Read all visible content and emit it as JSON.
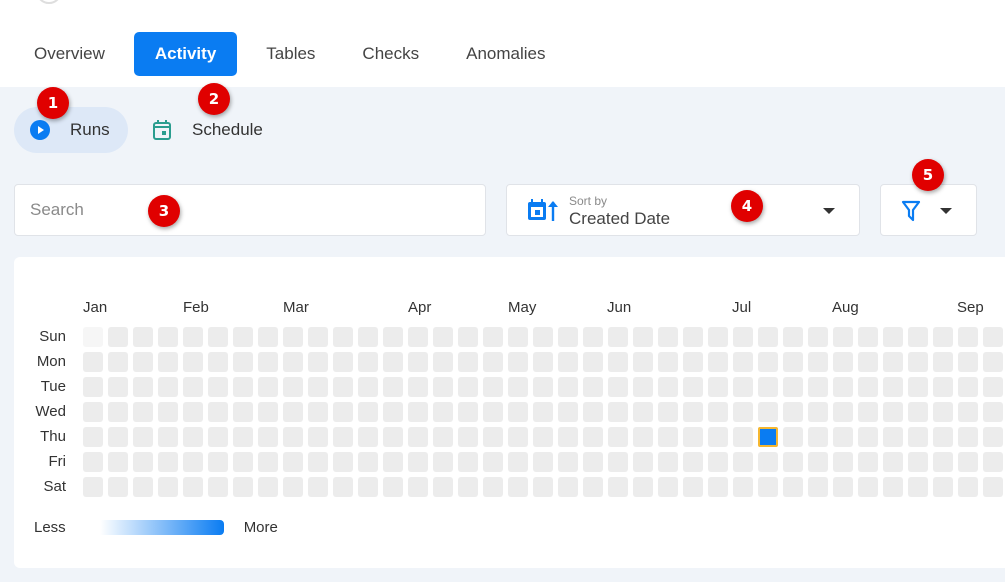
{
  "tabs": [
    {
      "label": "Overview",
      "active": false
    },
    {
      "label": "Activity",
      "active": true
    },
    {
      "label": "Tables",
      "active": false
    },
    {
      "label": "Checks",
      "active": false
    },
    {
      "label": "Anomalies",
      "active": false
    }
  ],
  "subtabs": {
    "runs": {
      "label": "Runs",
      "icon": "play-circle-icon",
      "active": true
    },
    "schedule": {
      "label": "Schedule",
      "icon": "calendar-icon",
      "active": false
    }
  },
  "search": {
    "placeholder": "Search",
    "value": ""
  },
  "sort": {
    "label": "Sort by",
    "value": "Created Date",
    "icon": "calendar-sort-icon"
  },
  "filter": {
    "icon": "filter-icon"
  },
  "heatmap": {
    "months": [
      "Jan",
      "Feb",
      "Mar",
      "Apr",
      "May",
      "Jun",
      "Jul",
      "Aug",
      "Sep"
    ],
    "days": [
      "Sun",
      "Mon",
      "Tue",
      "Wed",
      "Thu",
      "Fri",
      "Sat"
    ],
    "visible_weeks": 37,
    "out_of_range": [
      {
        "week": 0,
        "day": 0
      }
    ],
    "active_cells": [
      {
        "week": 27,
        "day": 4,
        "level": 1
      }
    ],
    "legend": {
      "less": "Less",
      "more": "More"
    }
  },
  "colors": {
    "accent": "#0a7cf2",
    "cell_empty": "#ececec",
    "cell_highlight_border": "#f5b731",
    "badge": "#e00000",
    "schedule_icon": "#2a9d8f"
  },
  "annotations": [
    "1",
    "2",
    "3",
    "4",
    "5"
  ]
}
